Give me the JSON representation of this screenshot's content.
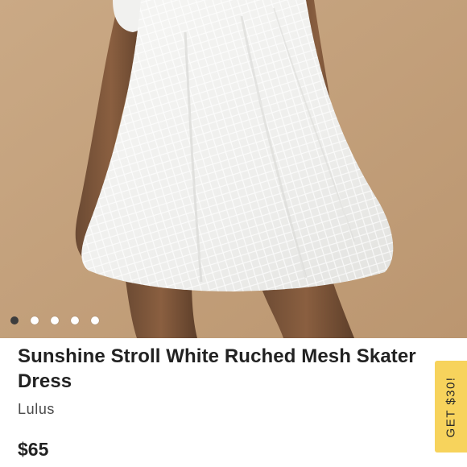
{
  "product": {
    "title": "Sunshine Stroll White Ruched Mesh Skater Dress",
    "brand": "Lulus",
    "price": "$65",
    "image_alt": "white mesh skater dress photo"
  },
  "carousel": {
    "total": 5,
    "active_index": 0
  },
  "promo": {
    "label": "GET $30!"
  },
  "colors": {
    "background_tan": "#c4a27f",
    "promo_yellow": "#f7d35c",
    "text_dark": "#222222"
  }
}
